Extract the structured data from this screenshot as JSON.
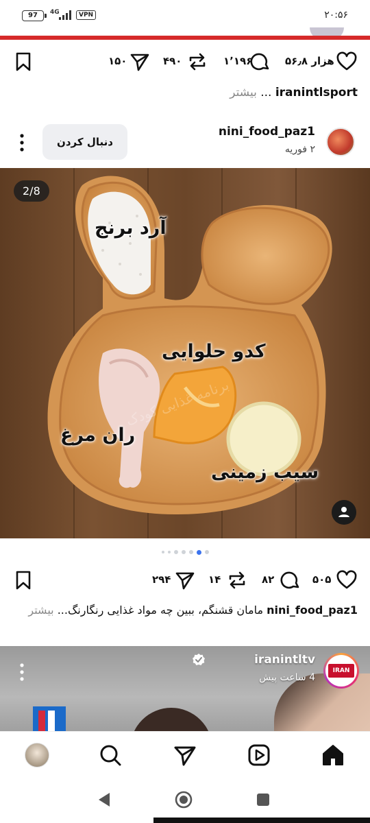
{
  "status_bar": {
    "time": "۲۰:۵۶",
    "battery": "97",
    "network": "4G",
    "vpn": "VPN"
  },
  "prev_post": {
    "likes": "۵۶٫۸ هزار",
    "comments": "۱٬۱۹۶",
    "reposts": "۴۹۰",
    "shares": "۱۵۰",
    "caption_user": "iranintlsport",
    "caption_text": " ... ",
    "more": "بیشتر"
  },
  "post": {
    "username": "nini_food_paz1",
    "date": "۲ فوریه",
    "follow_label": "دنبال کردن",
    "carousel_counter": "2/8",
    "labels": {
      "rice_flour": "آرد برنج",
      "pumpkin": "کدو حلوایی",
      "chicken_leg": "ران مرغ",
      "potato": "سیب زمینی"
    },
    "watermark": "برنامه غذایی کودک",
    "likes": "۵۰۵",
    "comments": "۸۲",
    "reposts": "۱۴",
    "shares": "۲۹۴",
    "caption_user": "nini_food_paz1",
    "caption_text": " مامان قشنگم، ببین چه مواد غذایی رنگارنگ... ",
    "more": "بیشتر",
    "dots_total": 7,
    "dots_active_index": 5
  },
  "next_post": {
    "username": "iranintltv",
    "time_ago": "4 ساعت پیش",
    "logo_text": "IRAN"
  },
  "colors": {
    "accent_blue": "#3b73ee",
    "brand_red": "#d62a2a"
  }
}
